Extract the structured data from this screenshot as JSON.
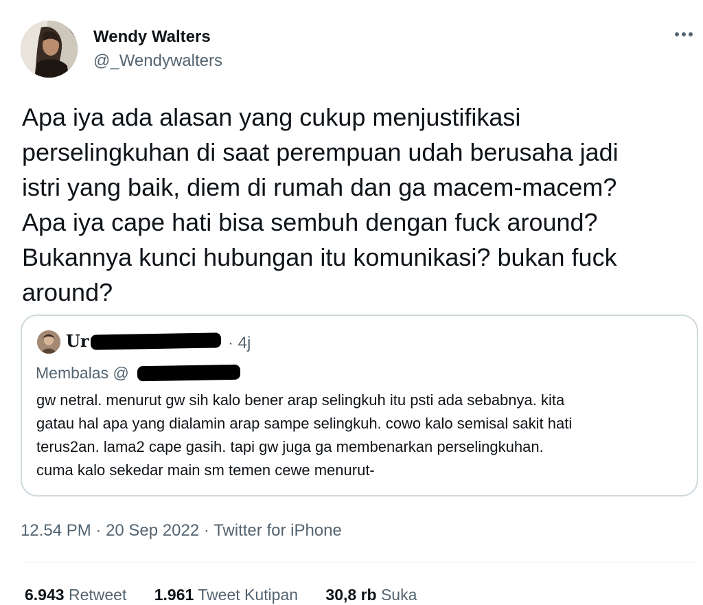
{
  "author": {
    "name": "Wendy Walters",
    "handle": "@_Wendywalters"
  },
  "tweet": {
    "text": "Apa iya ada alasan yang cukup menjustifikasi perselingkuhan di saat perempuan udah berusaha jadi istri yang baik, diem di rumah dan ga macem-macem? Apa iya cape hati bisa sembuh dengan fuck around? Bukannya kunci hubungan itu komunikasi? bukan fuck around?",
    "lines": [
      "Apa iya ada alasan yang cukup menjustifikasi",
      "perselingkuhan di saat perempuan udah berusaha jadi",
      "istri yang baik, diem di rumah dan ga macem-macem?",
      "Apa iya cape hati bisa sembuh dengan fuck around?",
      "Bukannya kunci hubungan itu komunikasi? bukan fuck",
      "around?"
    ]
  },
  "quote": {
    "name_prefix": "Ur",
    "time": "· 4j",
    "reply_prefix": "Membalas @",
    "lines": [
      "gw netral. menurut gw sih kalo bener arap selingkuh itu psti ada sebabnya. kita",
      "gatau hal apa yang dialamin arap sampe selingkuh. cowo kalo semisal sakit hati",
      "terus2an. lama2 cape gasih. tapi gw juga ga membenarkan perselingkuhan.",
      "cuma kalo sekedar main sm temen cewe menurut-"
    ]
  },
  "meta": {
    "time": "12.54 PM",
    "sep1": " · ",
    "date": "20 Sep 2022",
    "sep2": " · ",
    "source": "Twitter for iPhone"
  },
  "stats": [
    {
      "count": "6.943",
      "label": "Retweet"
    },
    {
      "count": "1.961",
      "label": "Tweet Kutipan"
    },
    {
      "count": "30,8 rb",
      "label": "Suka"
    }
  ],
  "icons": {
    "more": "more-horizontal-icon"
  },
  "colors": {
    "text": "#0f1419",
    "secondary": "#536471",
    "border": "#cfd9de"
  }
}
